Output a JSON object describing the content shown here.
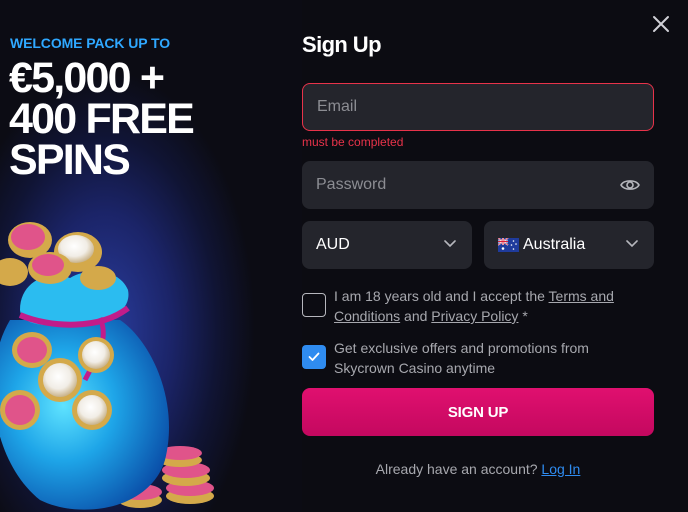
{
  "promo": {
    "subtitle": "WELCOME PACK UP TO",
    "headline_line1": "€5,000 +",
    "headline_line2": "400 FREE",
    "headline_line3": "SPINS"
  },
  "form": {
    "title": "Sign Up",
    "email": {
      "placeholder": "Email",
      "value": "",
      "error": "must be completed"
    },
    "password": {
      "placeholder": "Password",
      "value": ""
    },
    "currency": {
      "selected": "AUD"
    },
    "country": {
      "selected": "Australia",
      "flag_icon": "australia-flag-icon"
    },
    "age_checkbox": {
      "checked": false,
      "text_before": "I am 18 years old and I accept the ",
      "terms_link": "Terms and Conditions",
      "text_middle": " and ",
      "privacy_link": "Privacy Policy",
      "text_after": " *"
    },
    "offers_checkbox": {
      "checked": true,
      "text": "Get exclusive offers and promotions from Skycrown Casino anytime"
    },
    "submit_label": "SIGN UP",
    "login_prompt": "Already have an account?",
    "login_link": "Log In"
  },
  "icons": {
    "close": "close-icon",
    "eye": "eye-icon",
    "chevron": "chevron-down-icon",
    "check": "checkmark-icon"
  },
  "colors": {
    "accent_pink": "#e0106f",
    "accent_blue": "#2f8cf0",
    "error_red": "#e8334a",
    "promo_blue": "#2fa8ff",
    "field_bg": "#24252c",
    "page_bg": "#0c0c12"
  }
}
